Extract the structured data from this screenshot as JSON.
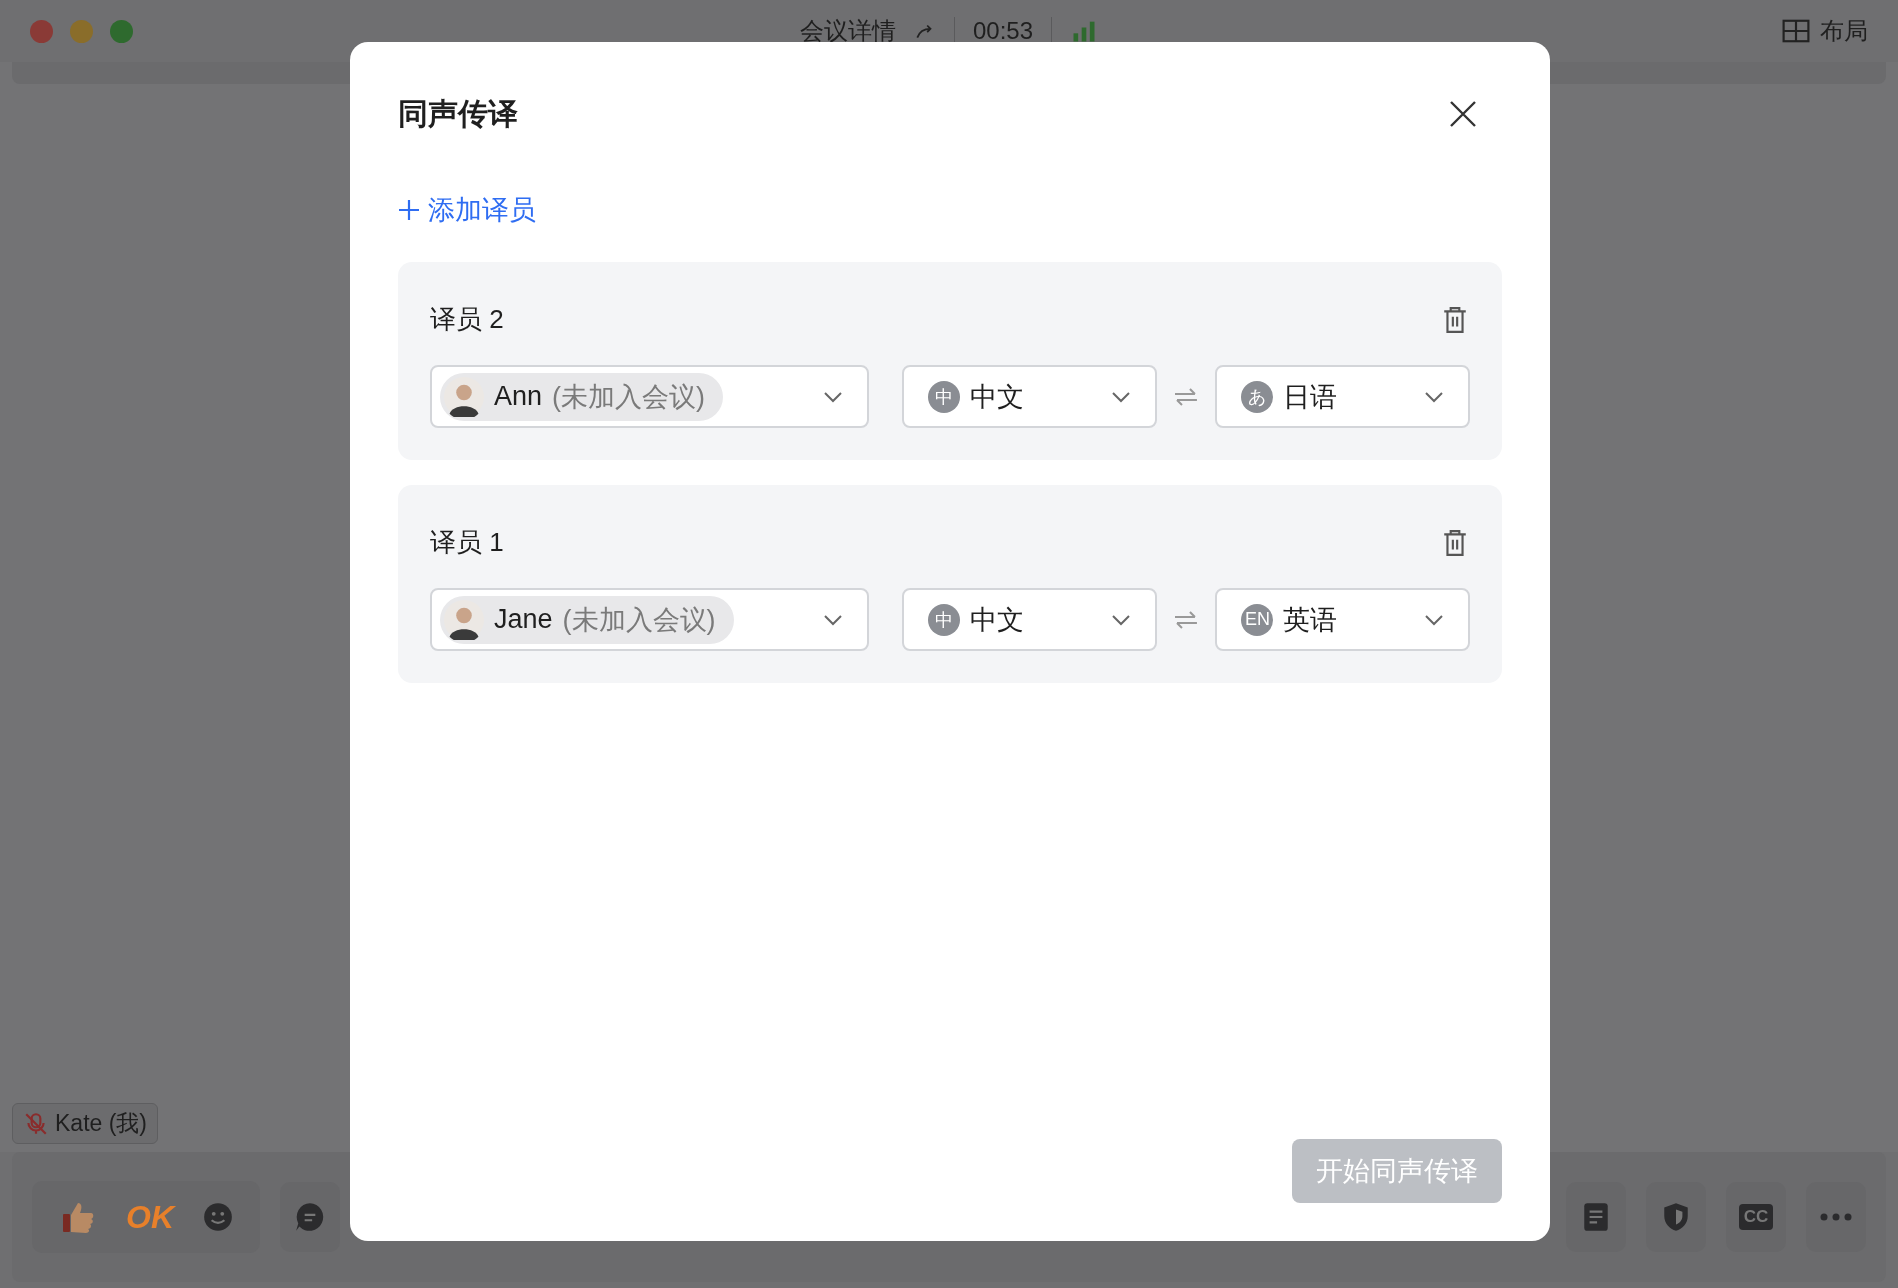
{
  "window": {
    "title": "会议详情",
    "timer": "00:53",
    "layout_label": "布局"
  },
  "self_tile": {
    "name": "Kate (我)",
    "muted": true
  },
  "toolbar": {
    "reaction_text": "OK",
    "cc_label": "CC"
  },
  "dialog": {
    "title": "同声传译",
    "add_link": "添加译员",
    "interpreters": [
      {
        "label": "译员 2",
        "name": "Ann",
        "status": "(未加入会议)",
        "source": {
          "badge": "中",
          "name": "中文"
        },
        "target": {
          "badge": "あ",
          "name": "日语"
        }
      },
      {
        "label": "译员 1",
        "name": "Jane",
        "status": "(未加入会议)",
        "source": {
          "badge": "中",
          "name": "中文"
        },
        "target": {
          "badge": "EN",
          "name": "英语"
        }
      }
    ],
    "start_button": {
      "label": "开始同声传译",
      "disabled": true
    }
  }
}
